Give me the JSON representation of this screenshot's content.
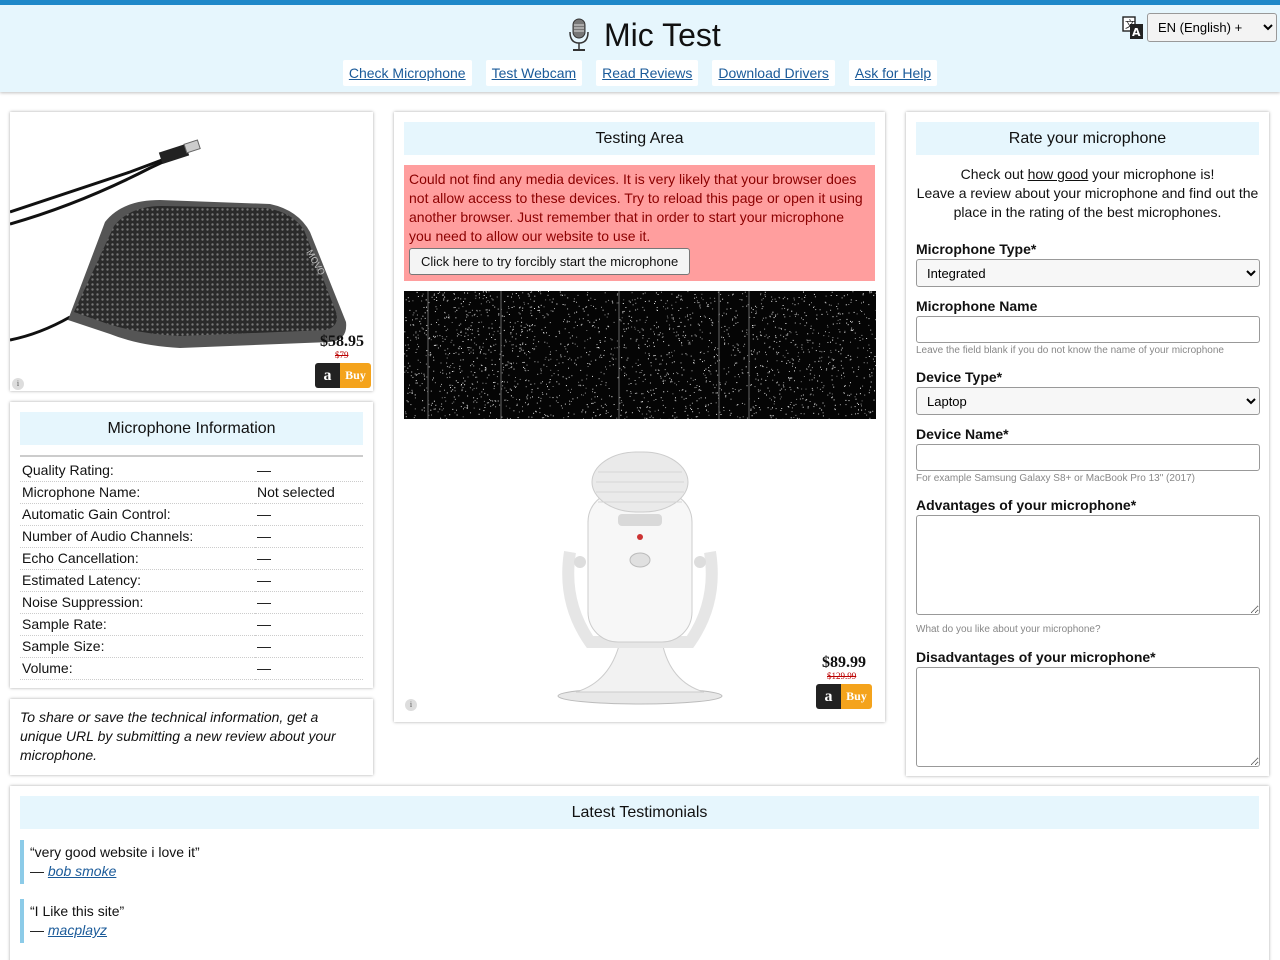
{
  "header": {
    "title": "Mic Test",
    "mic_icon": "microphone-icon",
    "language": "EN (English) +",
    "nav": [
      "Check Microphone",
      "Test Webcam",
      "Read Reviews",
      "Download Drivers",
      "Ask for Help"
    ]
  },
  "ad_left": {
    "price": "$58.95",
    "old_price": "$79",
    "buy": "Buy",
    "brand_letter": "a",
    "info": "i"
  },
  "mic_info": {
    "title": "Microphone Information",
    "rows": [
      {
        "label": "Quality Rating:",
        "value": "—"
      },
      {
        "label": "Microphone Name:",
        "value": "Not selected"
      },
      {
        "label": "Automatic Gain Control:",
        "value": "—"
      },
      {
        "label": "Number of Audio Channels:",
        "value": "—"
      },
      {
        "label": "Echo Cancellation:",
        "value": "—"
      },
      {
        "label": "Estimated Latency:",
        "value": "—"
      },
      {
        "label": "Noise Suppression:",
        "value": "—"
      },
      {
        "label": "Sample Rate:",
        "value": "—"
      },
      {
        "label": "Sample Size:",
        "value": "—"
      },
      {
        "label": "Volume:",
        "value": "—"
      }
    ]
  },
  "share_note": "To share or save the technical information, get a unique URL by submitting a new review about your microphone.",
  "testing": {
    "title": "Testing Area",
    "error": "Could not find any media devices. It is very likely that your browser does not allow access to these devices. Try to reload this page or open it using another browser. Just remember that in order to start your microphone you need to allow our website to use it.",
    "force_button": "Click here to try forcibly start the microphone",
    "ad": {
      "price": "$89.99",
      "old_price": "$129.99",
      "buy": "Buy",
      "brand_letter": "a",
      "info": "i"
    }
  },
  "rate": {
    "title": "Rate your microphone",
    "intro_pre": "Check out ",
    "intro_link": "how good",
    "intro_post": " your microphone is!",
    "intro_2": "Leave a review about your microphone and find out the place in the rating of the best microphones.",
    "mic_type_label": "Microphone Type*",
    "mic_type_value": "Integrated",
    "mic_name_label": "Microphone Name",
    "mic_name_hint": "Leave the field blank if you do not know the name of your microphone",
    "device_type_label": "Device Type*",
    "device_type_value": "Laptop",
    "device_name_label": "Device Name*",
    "device_name_hint": "For example Samsung Galaxy S8+ or MacBook Pro 13\" (2017)",
    "adv_label": "Advantages of your microphone*",
    "adv_hint": "What do you like about your microphone?",
    "disadv_label": "Disadvantages of your microphone*"
  },
  "testimonials": {
    "title": "Latest Testimonials",
    "items": [
      {
        "quote": "“very good website i love it”",
        "author": "bob smoke"
      },
      {
        "quote": "“I Like this site”",
        "author": "macplayz"
      }
    ]
  }
}
